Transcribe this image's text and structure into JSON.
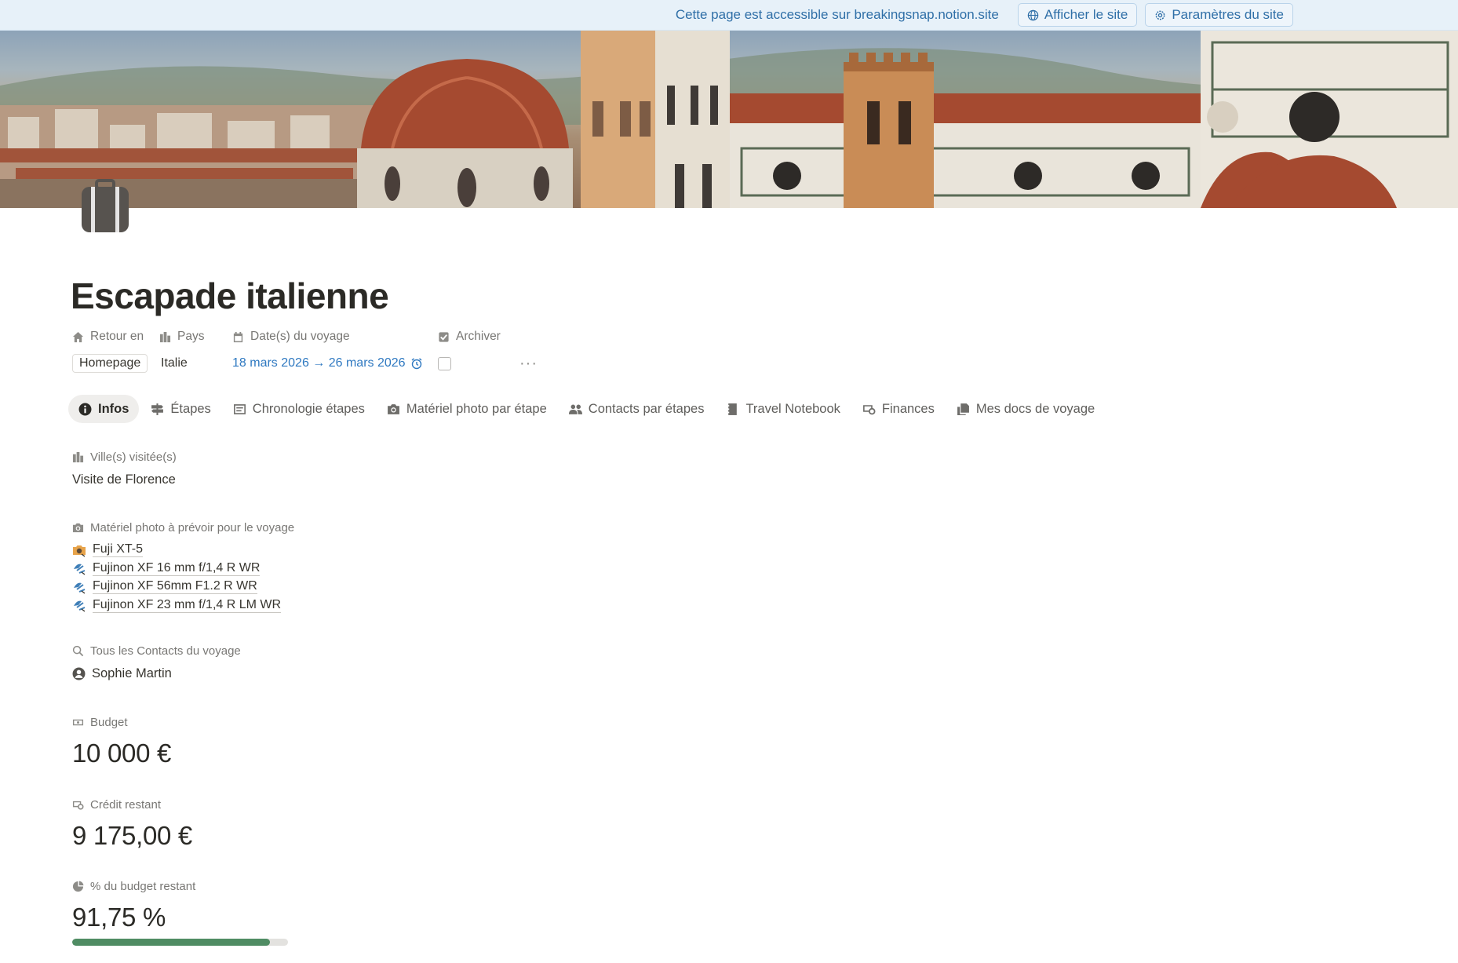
{
  "banner": {
    "notice": "Cette page est accessible sur breakingsnap.notion.site",
    "view_site": "Afficher le site",
    "site_settings": "Paramètres du site"
  },
  "page": {
    "icon": "suitcase-icon",
    "title": "Escapade italienne"
  },
  "properties": {
    "retour": {
      "label": "Retour en",
      "value": "Homepage",
      "icon": "home-icon"
    },
    "pays": {
      "label": "Pays",
      "value": "Italie",
      "icon": "city-icon"
    },
    "dates": {
      "label": "Date(s) du voyage",
      "value": "18 mars 2026 → 26 mars 2026",
      "icon": "calendar-icon"
    },
    "archiver": {
      "label": "Archiver",
      "checked": false,
      "icon": "checkbox-icon"
    },
    "more": "···"
  },
  "tabs": [
    {
      "label": "Infos",
      "icon": "info-icon",
      "active": true
    },
    {
      "label": "Étapes",
      "icon": "signpost-icon"
    },
    {
      "label": "Chronologie étapes",
      "icon": "timeline-icon"
    },
    {
      "label": "Matériel photo par étape",
      "icon": "camera-icon"
    },
    {
      "label": "Contacts par étapes",
      "icon": "people-icon"
    },
    {
      "label": "Travel Notebook",
      "icon": "notebook-icon"
    },
    {
      "label": "Finances",
      "icon": "money-icon"
    },
    {
      "label": "Mes docs de voyage",
      "icon": "documents-icon"
    }
  ],
  "sections": {
    "villes": {
      "label": "Ville(s) visitée(s)",
      "value": "Visite de Florence"
    },
    "materiel": {
      "label": "Matériel photo à prévoir pour le voyage",
      "items": [
        "Fuji XT-5",
        "Fujinon XF 16 mm f/1,4 R WR",
        "Fujinon XF 56mm F1.2 R WR",
        "Fujinon XF 23 mm f/1,4 R LM WR"
      ]
    },
    "contacts": {
      "label": "Tous les Contacts du voyage",
      "items": [
        "Sophie Martin"
      ]
    },
    "budget": {
      "label": "Budget",
      "value": "10 000 €"
    },
    "credit": {
      "label": "Crédit restant",
      "value": "9 175,00 €"
    },
    "percent": {
      "label": "% du budget restant",
      "value": "91,75 %",
      "progress": 0.9175,
      "bar_color": "#4f8c63"
    }
  },
  "colors": {
    "accent": "#2f79c1",
    "banner_bg": "#e7f1f9"
  }
}
